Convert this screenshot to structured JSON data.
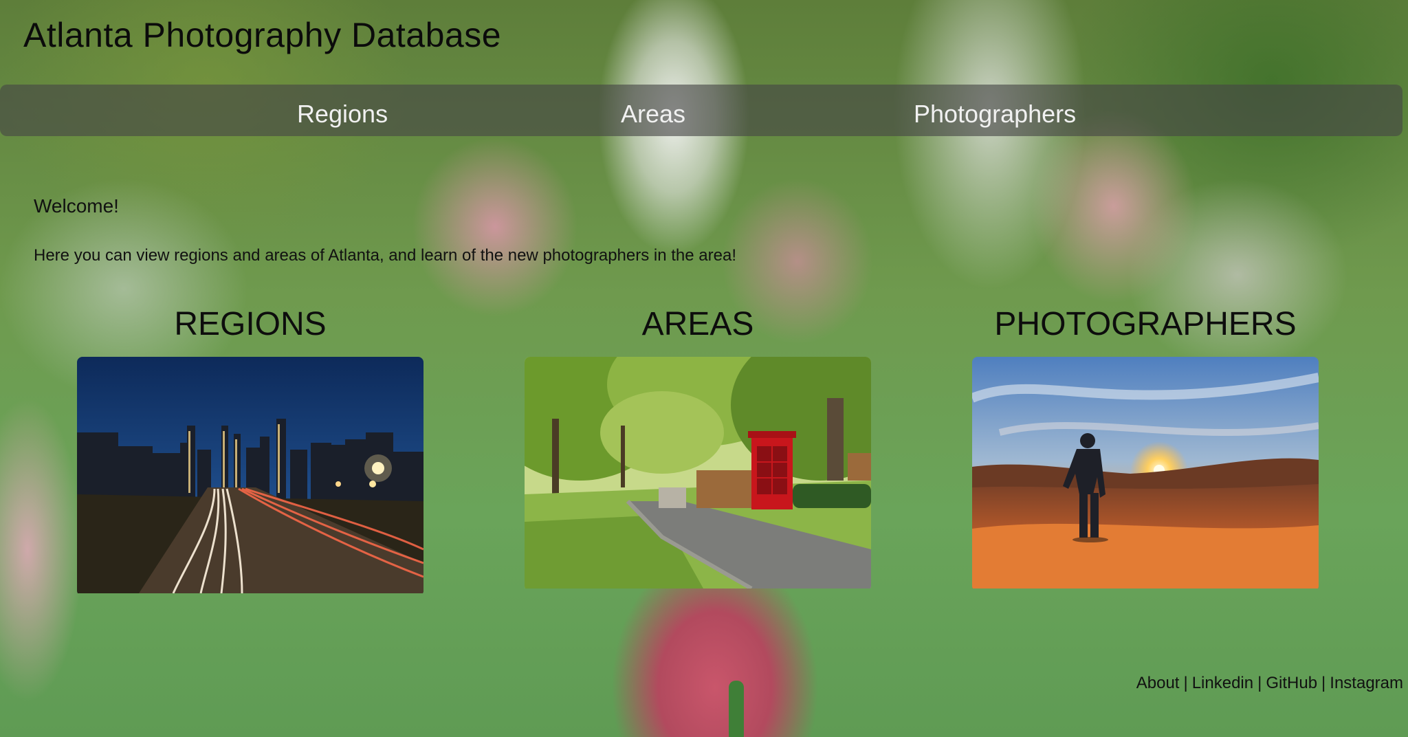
{
  "header": {
    "title": "Atlanta Photography Database"
  },
  "nav": {
    "items": [
      {
        "label": "Regions"
      },
      {
        "label": "Areas"
      },
      {
        "label": "Photographers"
      }
    ]
  },
  "main": {
    "welcome": "Welcome!",
    "intro": "Here you can view regions and areas of Atlanta, and learn of the new photographers in the area!",
    "cards": [
      {
        "title": "REGIONS",
        "image": "atlanta-skyline-night-highway-photo"
      },
      {
        "title": "AREAS",
        "image": "park-red-telephone-booth-photo"
      },
      {
        "title": "PHOTOGRAPHERS",
        "image": "man-in-desert-sunset-photo"
      }
    ]
  },
  "footer": {
    "links": [
      {
        "label": "About"
      },
      {
        "label": "Linkedin"
      },
      {
        "label": "GitHub"
      },
      {
        "label": "Instagram"
      }
    ],
    "separator": "|"
  }
}
